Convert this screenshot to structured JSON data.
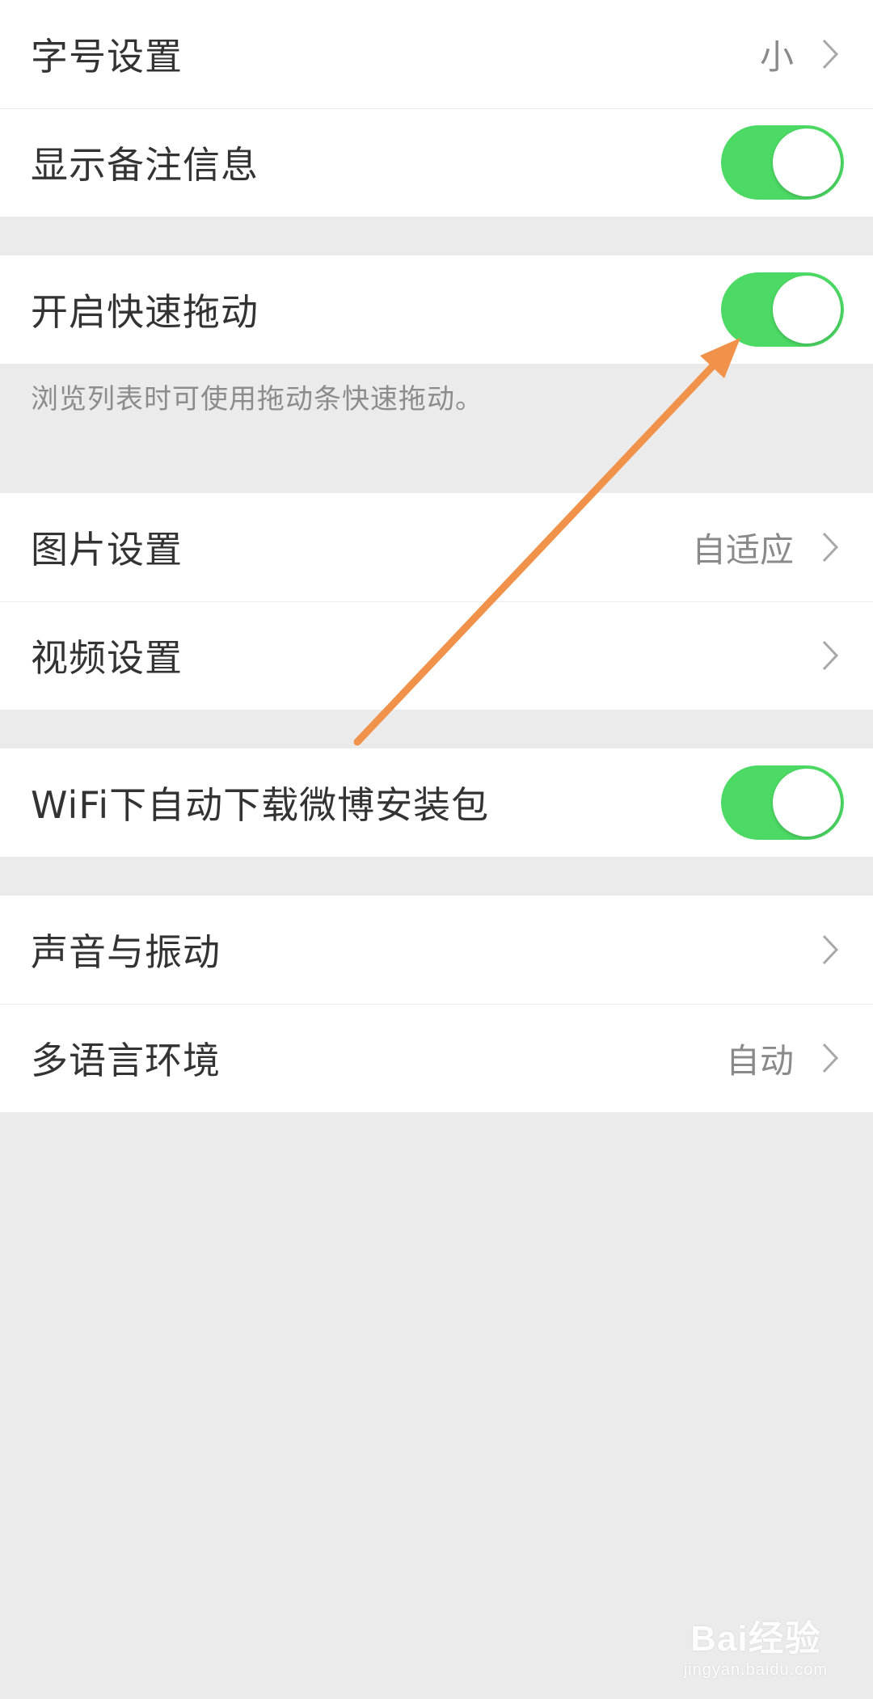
{
  "settings": {
    "font_size": {
      "label": "字号设置",
      "value": "小"
    },
    "show_remark": {
      "label": "显示备注信息",
      "enabled": true
    },
    "fast_drag": {
      "label": "开启快速拖动",
      "enabled": true,
      "note": "浏览列表时可使用拖动条快速拖动。"
    },
    "image": {
      "label": "图片设置",
      "value": "自适应"
    },
    "video": {
      "label": "视频设置"
    },
    "wifi_download": {
      "label": "WiFi下自动下载微博安装包",
      "enabled": true
    },
    "sound_vibration": {
      "label": "声音与振动"
    },
    "language": {
      "label": "多语言环境",
      "value": "自动"
    }
  },
  "colors": {
    "toggle_on": "#4cd964",
    "annotation_arrow": "#f0924a",
    "background": "#ebebeb"
  },
  "watermark": {
    "main": "Bai经验",
    "sub": "jingyan.baidu.com"
  }
}
